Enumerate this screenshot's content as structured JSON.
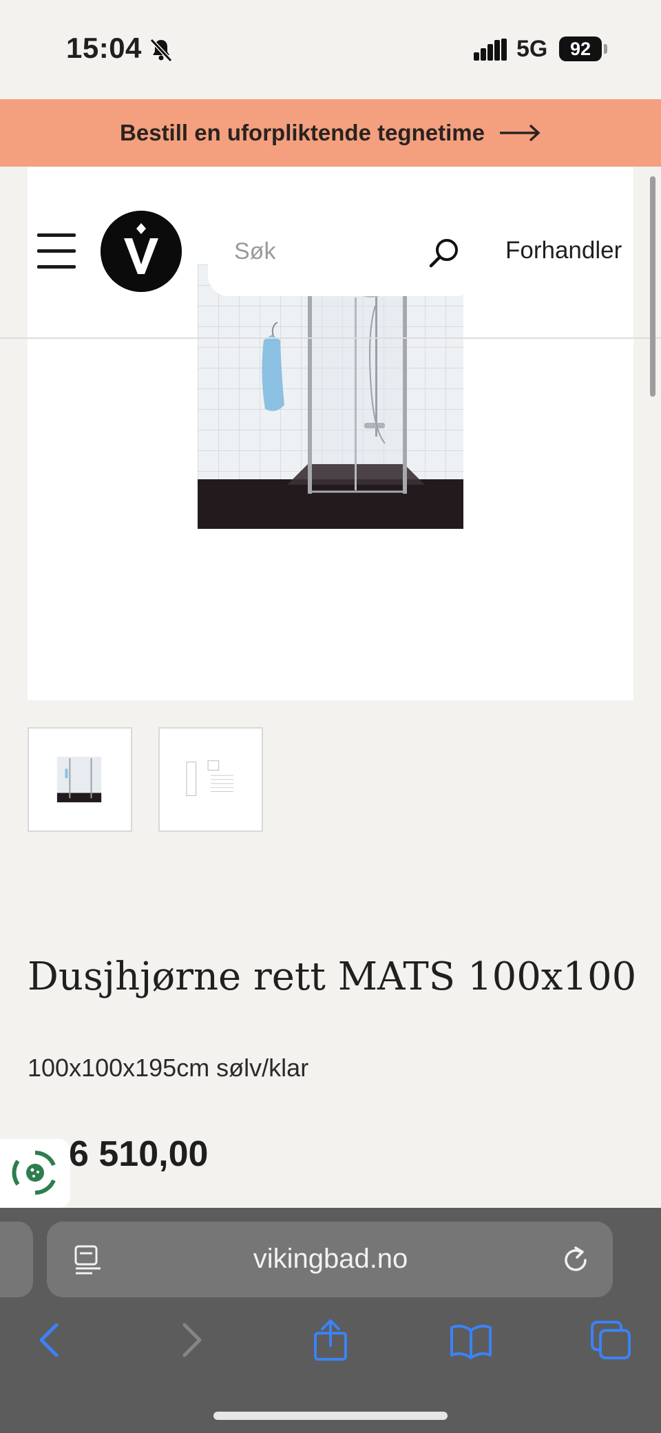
{
  "status_bar": {
    "time": "15:04",
    "network": "5G",
    "battery": "92"
  },
  "promo": {
    "text": "Bestill en uforpliktende tegnetime"
  },
  "header": {
    "search_placeholder": "Søk",
    "dealer_label": "Forhandler"
  },
  "product": {
    "title": "Dusjhjørne rett MATS 100x100",
    "subtitle": "100x100x195cm sølv/klar",
    "price": "6 510,00",
    "thumbnails": [
      {
        "label": "Produktbilde"
      },
      {
        "label": "Målskisse"
      }
    ]
  },
  "browser": {
    "url": "vikingbad.no"
  },
  "colors": {
    "promo_bg": "#f4a07e",
    "page_bg": "#f3f2ef",
    "browser_bg": "#5c5c5c",
    "ios_blue": "#3b82f6",
    "cookie_green": "#2e7d4f"
  }
}
